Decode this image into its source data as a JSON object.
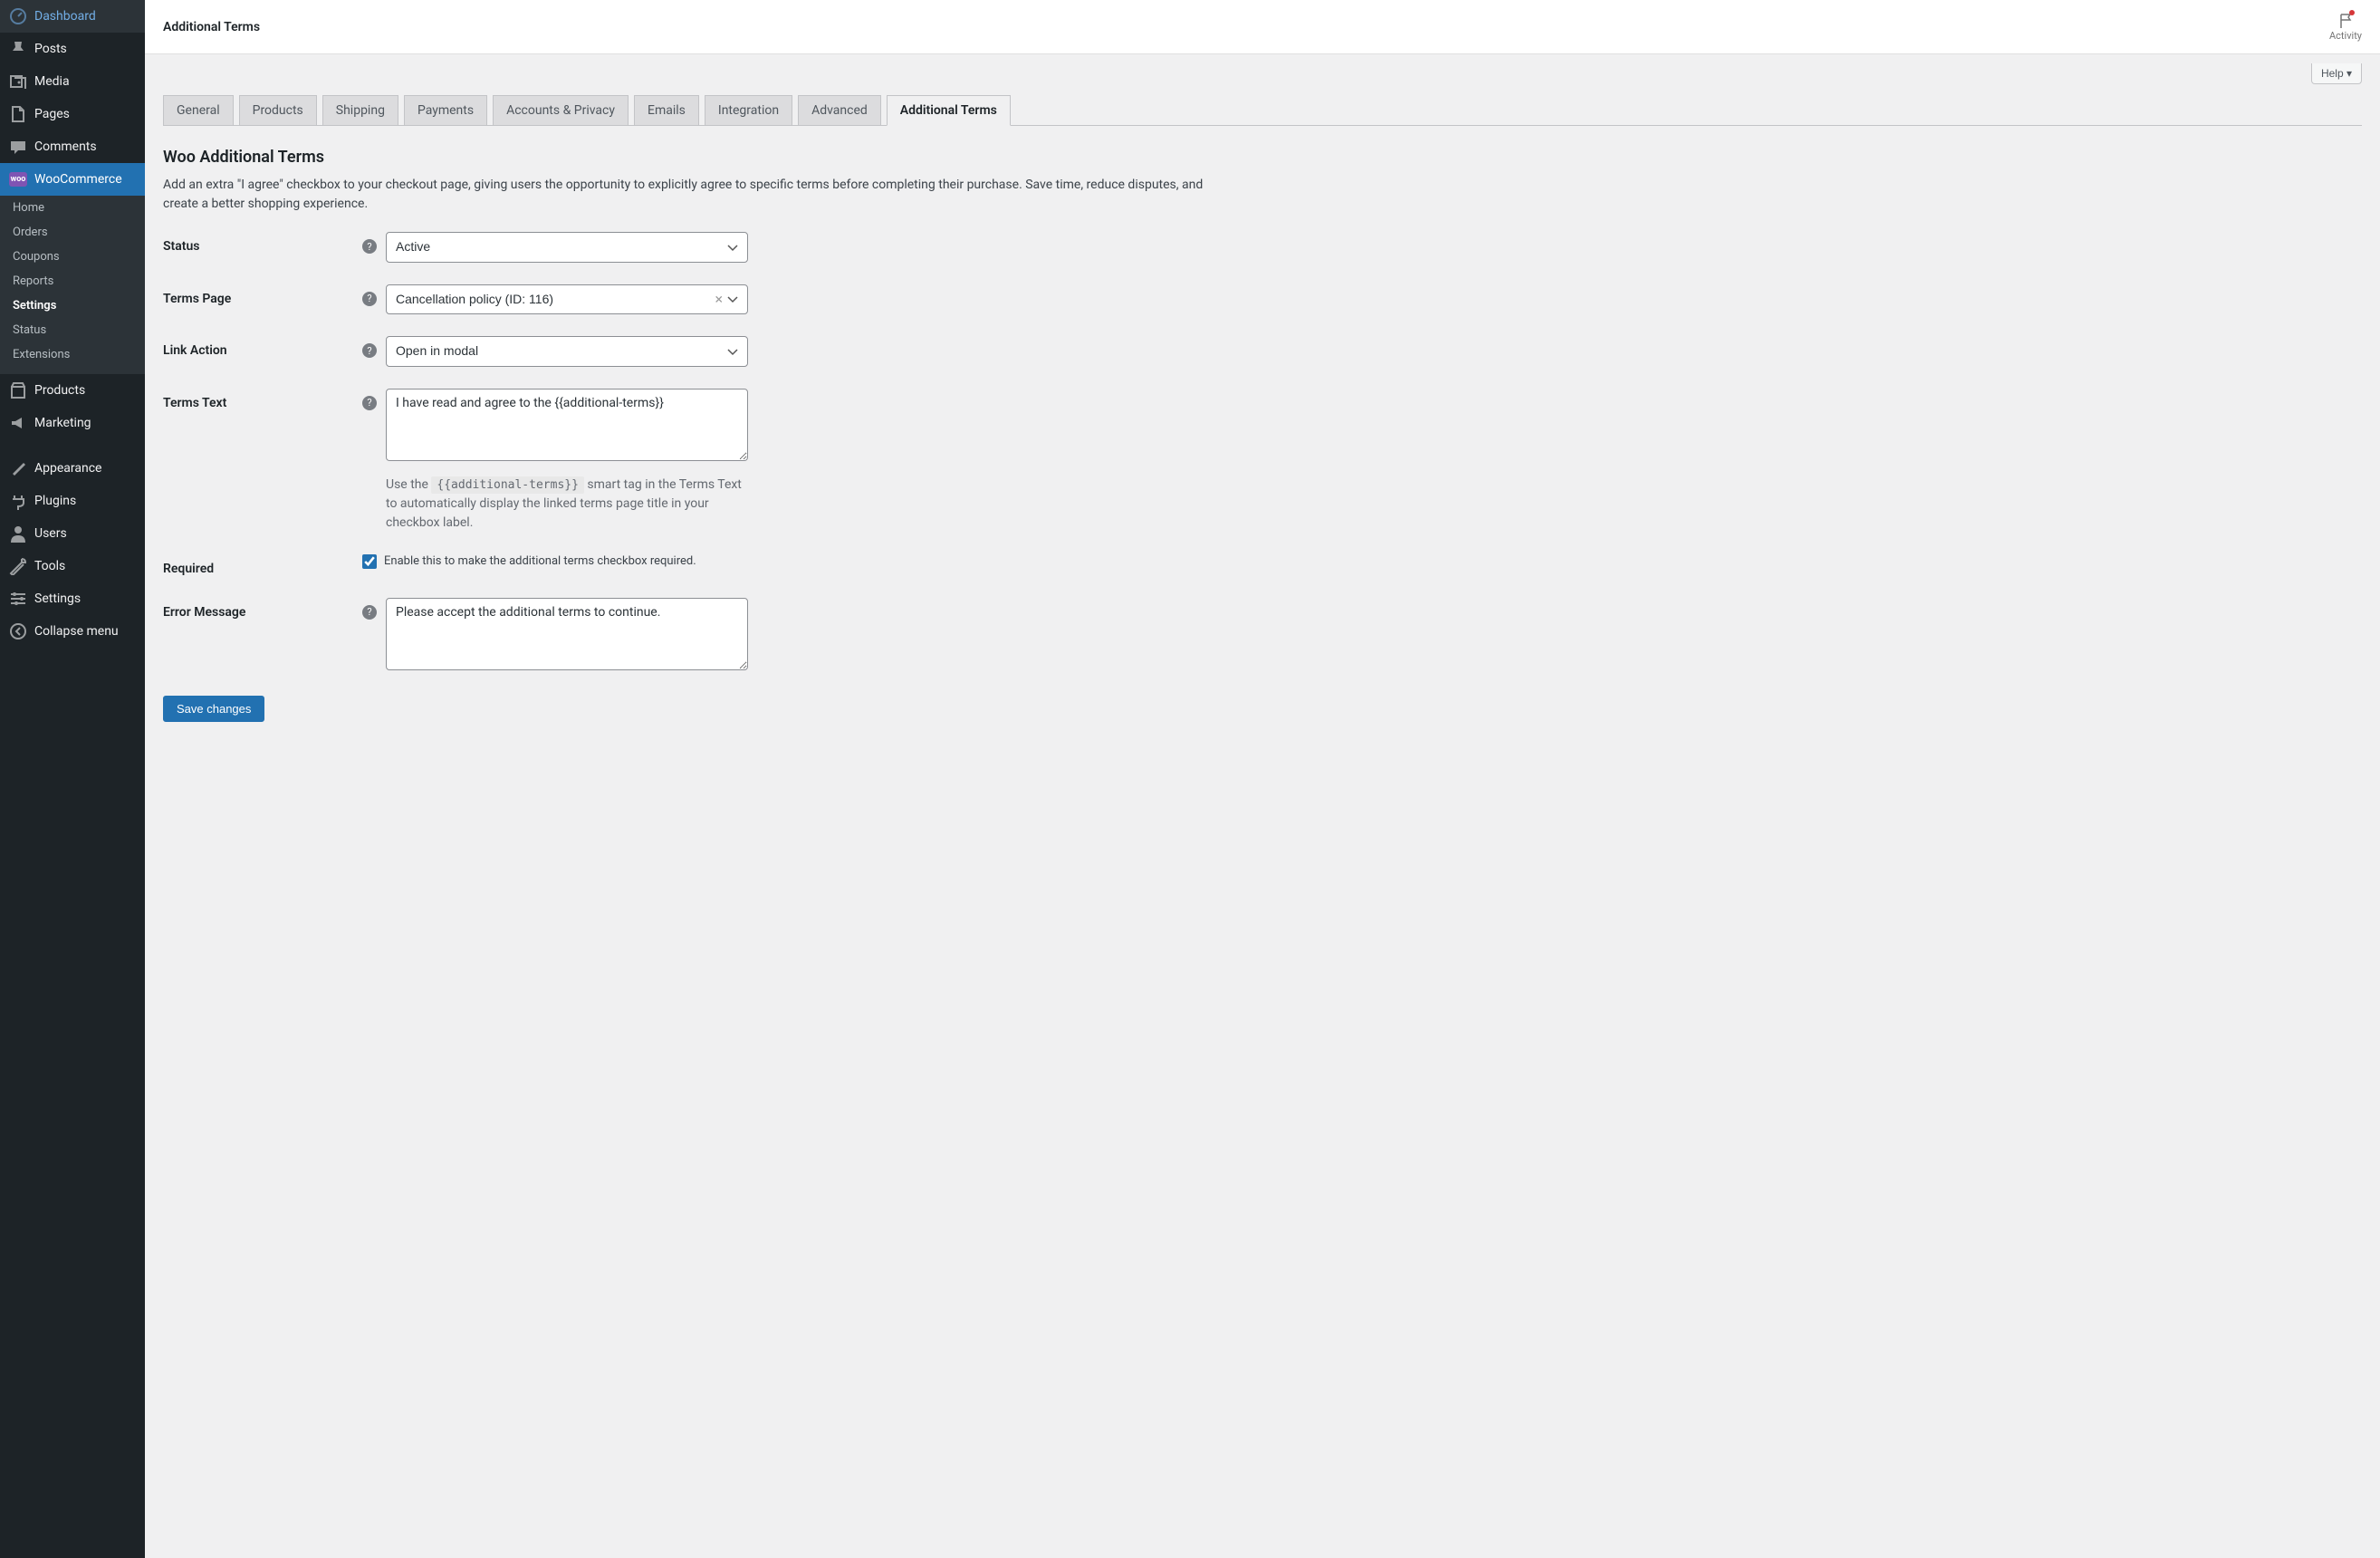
{
  "sidebar": {
    "items": [
      {
        "label": "Dashboard"
      },
      {
        "label": "Posts"
      },
      {
        "label": "Media"
      },
      {
        "label": "Pages"
      },
      {
        "label": "Comments"
      },
      {
        "label": "WooCommerce"
      },
      {
        "label": "Products"
      },
      {
        "label": "Marketing"
      },
      {
        "label": "Appearance"
      },
      {
        "label": "Plugins"
      },
      {
        "label": "Users"
      },
      {
        "label": "Tools"
      },
      {
        "label": "Settings"
      },
      {
        "label": "Collapse menu"
      }
    ],
    "woo_submenu": [
      {
        "label": "Home"
      },
      {
        "label": "Orders"
      },
      {
        "label": "Coupons"
      },
      {
        "label": "Reports"
      },
      {
        "label": "Settings"
      },
      {
        "label": "Status"
      },
      {
        "label": "Extensions"
      }
    ]
  },
  "topbar": {
    "title": "Additional Terms",
    "activity": "Activity"
  },
  "help_button": "Help",
  "tabs": [
    {
      "label": "General"
    },
    {
      "label": "Products"
    },
    {
      "label": "Shipping"
    },
    {
      "label": "Payments"
    },
    {
      "label": "Accounts & Privacy"
    },
    {
      "label": "Emails"
    },
    {
      "label": "Integration"
    },
    {
      "label": "Advanced"
    },
    {
      "label": "Additional Terms"
    }
  ],
  "section": {
    "title": "Woo Additional Terms",
    "description": "Add an extra \"I agree\" checkbox to your checkout page, giving users the opportunity to explicitly agree to specific terms before completing their purchase. Save time, reduce disputes, and create a better shopping experience."
  },
  "fields": {
    "status": {
      "label": "Status",
      "value": "Active"
    },
    "terms_page": {
      "label": "Terms Page",
      "value": "Cancellation policy (ID: 116)"
    },
    "link_action": {
      "label": "Link Action",
      "value": "Open in modal"
    },
    "terms_text": {
      "label": "Terms Text",
      "value": "I have read and agree to the {{additional-terms}}",
      "help_pre": "Use the ",
      "help_code": "{{additional-terms}}",
      "help_post": " smart tag in the Terms Text to automatically display the linked terms page title in your checkbox label."
    },
    "required": {
      "label": "Required",
      "checkbox_label": "Enable this to make the additional terms checkbox required.",
      "checked": true
    },
    "error_message": {
      "label": "Error Message",
      "value": "Please accept the additional terms to continue."
    }
  },
  "save_button": "Save changes"
}
